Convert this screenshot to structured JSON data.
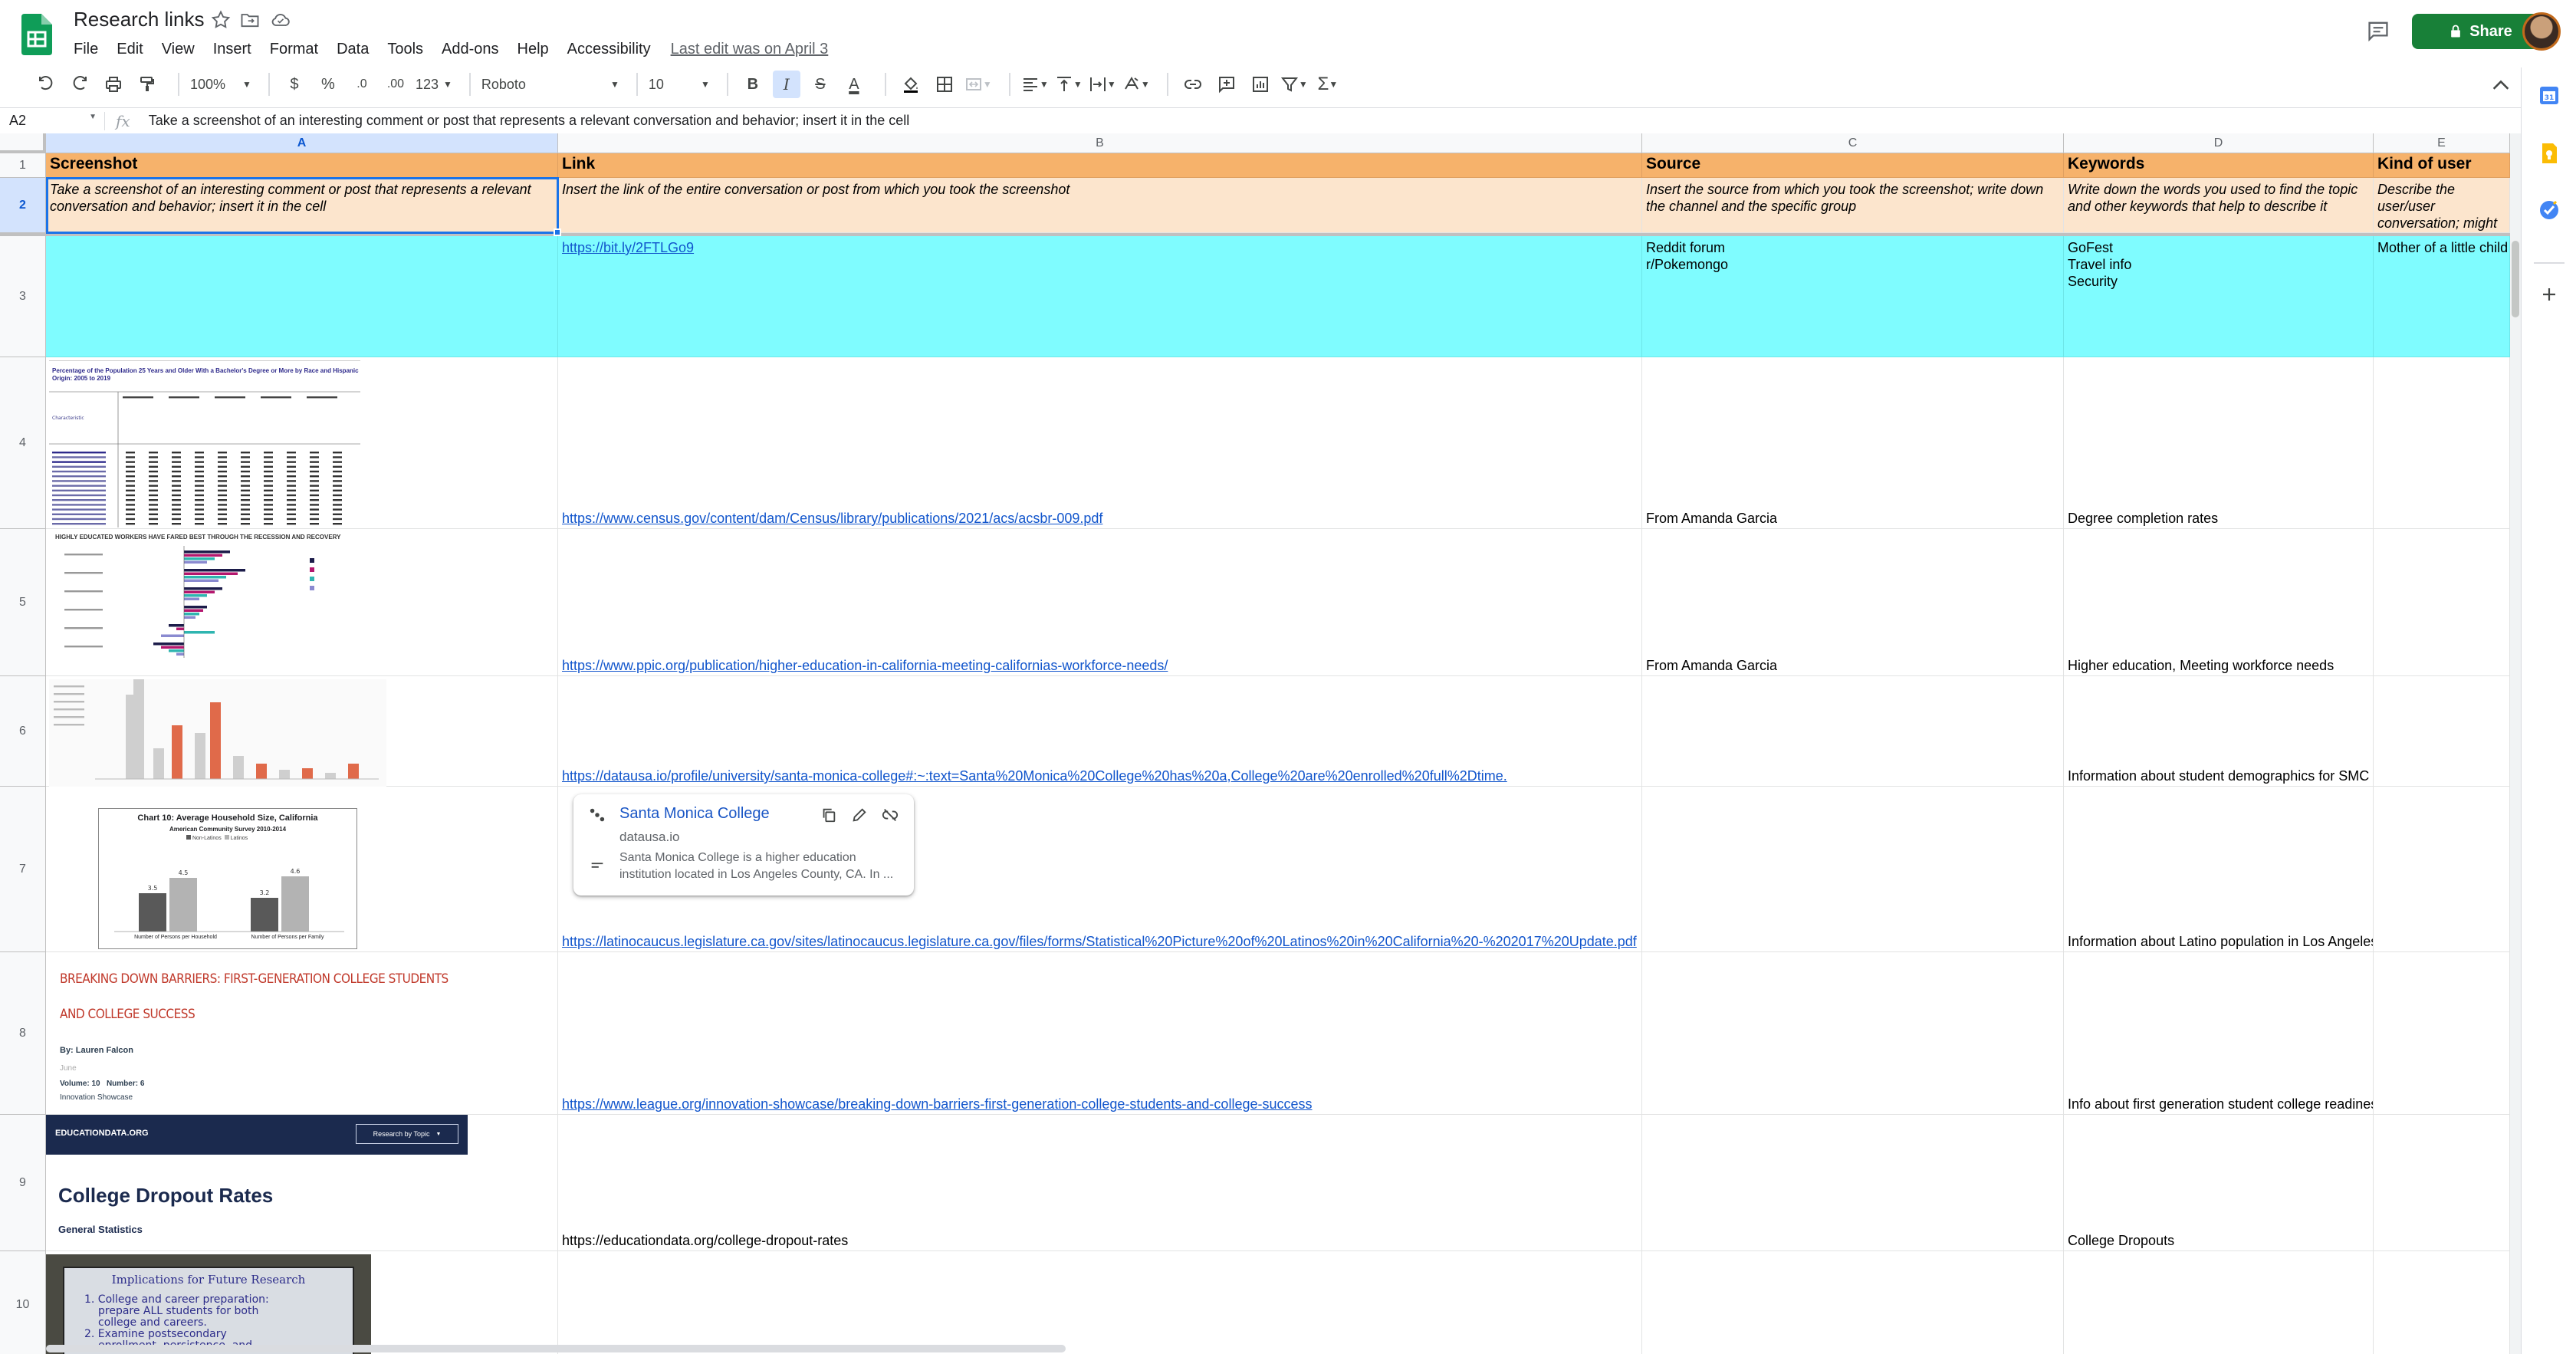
{
  "doc": {
    "title": "Research links",
    "menus": [
      "File",
      "Edit",
      "View",
      "Insert",
      "Format",
      "Data",
      "Tools",
      "Add-ons",
      "Help",
      "Accessibility"
    ],
    "last_edit": "Last edit was on April 3",
    "share_label": "Share"
  },
  "toolbar": {
    "zoom": "100%",
    "currency": "$",
    "percent": "%",
    "decimal_decrease": ".0",
    "decimal_increase": ".00",
    "number_format": "123",
    "font": "Roboto",
    "font_size": "10",
    "bold": "B",
    "italic": "I",
    "strike": "S",
    "text_color": "A"
  },
  "formula_bar": {
    "cell_ref": "A2",
    "fx": "fx",
    "value": "Take a screenshot of an interesting comment or post that represents a relevant conversation and behavior; insert it in the cell"
  },
  "columns": [
    "A",
    "B",
    "C",
    "D",
    "E"
  ],
  "rows": [
    "1",
    "2",
    "3",
    "4",
    "5",
    "6",
    "7",
    "8",
    "9",
    "10"
  ],
  "header_row": [
    "Screenshot",
    "Link",
    "Source",
    "Keywords",
    "Kind of user"
  ],
  "instruction_row": [
    "Take a screenshot of an interesting comment or post that represents a relevant conversation and behavior; insert it in the cell",
    "Insert the link of the entire conversation or post from which you took the screenshot",
    "Insert the source from which you took the screenshot; write down the channel and the specific group",
    "Write down the words you used to find the topic and other keywords that help to describe it",
    "Describe the user/user conversation; might be professor, etc..."
  ],
  "data_rows": [
    {
      "link": "https://bit.ly/2FTLGo9",
      "source": "Reddit forum\n r/Pokemongo",
      "keywords": "GoFest\nTravel info\nSecurity",
      "user": "Mother of a little child"
    },
    {
      "link": "https://www.census.gov/content/dam/Census/library/publications/2021/acs/acsbr-009.pdf",
      "source": "From Amanda Garcia",
      "keywords": "Degree completion rates",
      "user": ""
    },
    {
      "link": "https://www.ppic.org/publication/higher-education-in-california-meeting-californias-workforce-needs/",
      "source": "From Amanda Garcia",
      "keywords": "Higher education, Meeting workforce needs",
      "user": ""
    },
    {
      "link": "https://datausa.io/profile/university/santa-monica-college#:~:text=Santa%20Monica%20College%20has%20a,College%20are%20enrolled%20full%2Dtime.",
      "source": "",
      "keywords": "Information about student demographics for SMC",
      "user": ""
    },
    {
      "link": "https://latinocaucus.legislature.ca.gov/sites/latinocaucus.legislature.ca.gov/files/forms/Statistical%20Picture%20of%20Latinos%20in%20California%20-%202017%20Update.pdf",
      "source": "",
      "keywords": "Information about Latino population in Los Angeles",
      "user": ""
    },
    {
      "link": "https://www.league.org/innovation-showcase/breaking-down-barriers-first-generation-college-students-and-college-success",
      "source": "",
      "keywords": "Info about first generation student college readiness",
      "user": ""
    },
    {
      "link": "https://educationdata.org/college-dropout-rates",
      "source": "",
      "keywords": "College Dropouts",
      "user": "",
      "plain": true
    },
    {
      "link": "",
      "source": "",
      "keywords": "",
      "user": ""
    }
  ],
  "thumbnails": {
    "census_title": "Percentage of the Population 25 Years and Older With a Bachelor's Degree or More by Race and Hispanic Origin: 2005 to 2019",
    "ppic_title": "HIGHLY EDUCATED WORKERS HAVE FARED BEST THROUGH THE RECESSION AND RECOVERY",
    "household_title": "Chart 10: Average Household Size, California",
    "household_sub": "American Community Survey 2010-2014",
    "household_legend": [
      "Non-Latinos",
      "Latinos"
    ],
    "household_values": [
      "3.5",
      "4.5",
      "3.2",
      "4.6"
    ],
    "household_categories": [
      "Number of Persons per Household",
      "Number of Persons per Family"
    ],
    "barriers_title": "BREAKING DOWN BARRIERS: FIRST-GENERATION COLLEGE STUDENTS AND COLLEGE SUCCESS",
    "barriers_author": "By: Lauren Falcon",
    "barriers_month": "June",
    "barriers_volume": "Volume: 10",
    "barriers_number": "Number: 6",
    "barriers_section": "Innovation Showcase",
    "edu_brand": "EDUCATIONDATA.ORG",
    "edu_menu": "Research by Topic",
    "edu_title": "College Dropout Rates",
    "edu_subtitle": "General Statistics",
    "slide_title": "Implications for Future Research",
    "slide_lines": [
      "1. College and career preparation:",
      "prepare ALL students for both",
      "college and careers.",
      "2. Examine postsecondary",
      "enrollment, persistence, and"
    ]
  },
  "chip": {
    "title": "Santa Monica College",
    "domain": "datausa.io",
    "description": "Santa Monica College is a higher education institution located in Los Angeles County, CA. In ..."
  }
}
